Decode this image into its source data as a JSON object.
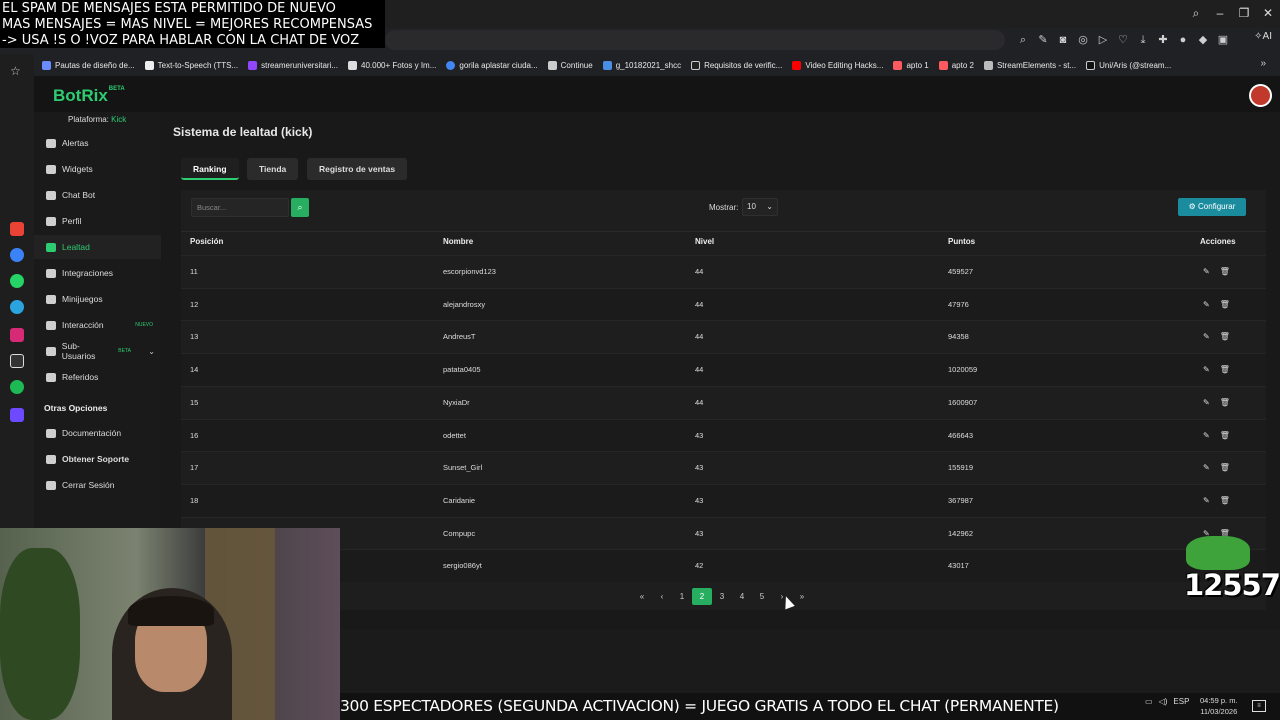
{
  "overlay": {
    "line1": "EL SPAM DE MENSAJES ESTA PERMITIDO DE NUEVO",
    "line2": "MAS MENSAJES = MAS NIVEL = MEJORES RECOMPENSAS",
    "line3": "-> USA !S O !VOZ PARA HABLAR CON LA CHAT DE VOZ"
  },
  "browser": {
    "ai_label": "AI",
    "bookmarks": [
      "Pautas de diseño de...",
      "Text-to-Speech (TTS...",
      "streameruniversitari...",
      "40.000+ Fotos y Im...",
      "gorila aplastar ciuda...",
      "Continue",
      "g_10182021_shcc",
      "Requisitos de verific...",
      "Video Editing Hacks...",
      "apto 1",
      "apto 2",
      "StreamElements - st...",
      "Uni/Aris (@stream..."
    ]
  },
  "app": {
    "logo": "BotRix",
    "logo_badge": "BETA",
    "platform_label": "Plataforma:",
    "platform_value": "Kick"
  },
  "sidebar": {
    "items": [
      {
        "label": "Alertas"
      },
      {
        "label": "Widgets"
      },
      {
        "label": "Chat Bot"
      },
      {
        "label": "Perfil"
      },
      {
        "label": "Lealtad"
      },
      {
        "label": "Integraciones"
      },
      {
        "label": "Minijuegos"
      },
      {
        "label": "Interacción",
        "badge": "NUEVO"
      },
      {
        "label": "Sub-Usuarios",
        "badge": "BETA"
      },
      {
        "label": "Referidos"
      }
    ],
    "section_title": "Otras Opciones",
    "extra": [
      {
        "label": "Documentación"
      },
      {
        "label": "Obtener Soporte"
      },
      {
        "label": "Cerrar Sesión"
      }
    ]
  },
  "page": {
    "title": "Sistema de lealtad (kick)",
    "tabs": [
      "Ranking",
      "Tienda",
      "Registro de ventas"
    ],
    "search_placeholder": "Buscar...",
    "show_label": "Mostrar:",
    "show_value": "10",
    "config_label": "Configurar"
  },
  "table": {
    "headers": [
      "Posición",
      "Nombre",
      "Nivel",
      "Puntos",
      "Acciones"
    ],
    "rows": [
      {
        "pos": "11",
        "name": "escorpionvd123",
        "level": "44",
        "points": "459527"
      },
      {
        "pos": "12",
        "name": "alejandrosxy",
        "level": "44",
        "points": "47976"
      },
      {
        "pos": "13",
        "name": "AndreusT",
        "level": "44",
        "points": "94358"
      },
      {
        "pos": "14",
        "name": "patata0405",
        "level": "44",
        "points": "1020059"
      },
      {
        "pos": "15",
        "name": "NyxiaDr",
        "level": "44",
        "points": "1600907"
      },
      {
        "pos": "16",
        "name": "odettet",
        "level": "43",
        "points": "466643"
      },
      {
        "pos": "17",
        "name": "Sunset_Girl",
        "level": "43",
        "points": "155919"
      },
      {
        "pos": "18",
        "name": "Caridanie",
        "level": "43",
        "points": "367987"
      },
      {
        "pos": "",
        "name": "Compupc",
        "level": "43",
        "points": "142962"
      },
      {
        "pos": "",
        "name": "sergio086yt",
        "level": "42",
        "points": "43017"
      }
    ]
  },
  "pagination": {
    "first": "«",
    "prev": "‹",
    "pages": [
      "1",
      "2",
      "3",
      "4",
      "5"
    ],
    "current": "2",
    "next": "›",
    "last": "»"
  },
  "stream": {
    "counter": "12557",
    "ticker": "300 ESPECTADORES (SEGUNDA ACTIVACION) = JUEGO GRATIS A TODO EL CHAT (PERMANENTE)",
    "lang": "ESP",
    "time": "04:59 p. m.",
    "date": "11/03/2026"
  },
  "colors": {
    "accent": "#2ecc71",
    "config": "#1a8c9e"
  }
}
